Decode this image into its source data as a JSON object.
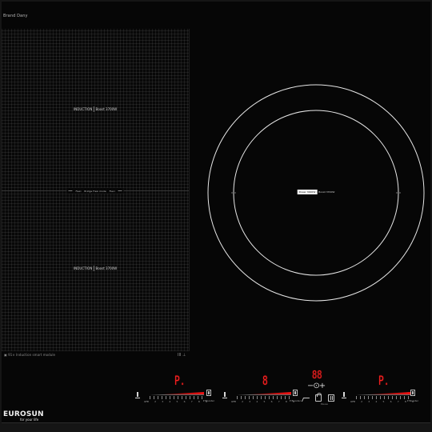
{
  "header": {
    "top_note": "Brand Dany"
  },
  "flex_zone": {
    "upper_label_main": "INDUCTION",
    "upper_label_boost": "Boost 3700W",
    "center_label_left": "Flexi",
    "center_label_mid": "Bridge Flexi mode",
    "center_label_right": "Flexi",
    "lower_label_main": "INDUCTION",
    "lower_label_boost": "Boost 3700W",
    "bottom_text": "▣ 91× Induction smart module",
    "bottom_symbols": "III ⊥"
  },
  "round_zone": {
    "label_main": "Power 3000W",
    "label_secondary": "Boost 3700W"
  },
  "controls": {
    "left_display": "P.",
    "middle_display": "8",
    "timer_display": "88",
    "right_display": "P.",
    "timer_symbols": "−⊙+",
    "function_caption": "Pause",
    "slider_numbers": [
      "1",
      "2",
      "3",
      "4",
      "5",
      "6",
      "7",
      "8",
      "9"
    ],
    "slider_min": "OFF",
    "slider_boost_caption": "P Booster"
  },
  "brand": {
    "name": "EUROSUN",
    "tagline": "for your life"
  },
  "colors": {
    "glass": "#060606",
    "frame": "#151515",
    "display_red": "#ff2020",
    "line_gray": "#d8d8d8"
  },
  "icons": [
    "left-power-icon",
    "left-boost-icon",
    "middle-power-icon",
    "middle-boost-icon",
    "stairs-icon",
    "lock-icon",
    "pause-icon",
    "right-power-icon",
    "right-boost-icon"
  ]
}
